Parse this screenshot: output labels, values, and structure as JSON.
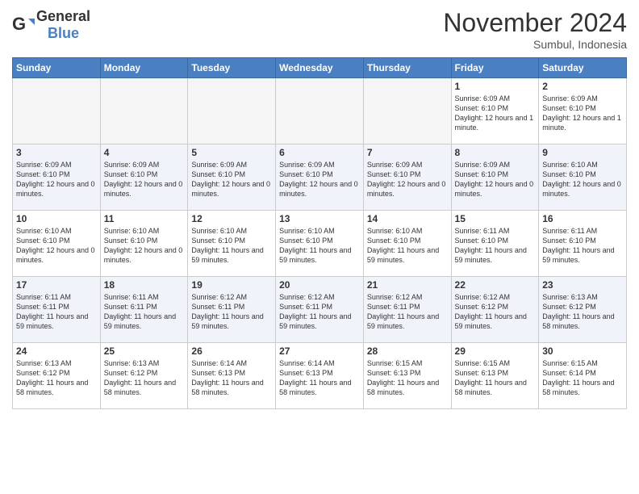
{
  "logo": {
    "text_general": "General",
    "text_blue": "Blue"
  },
  "header": {
    "month_title": "November 2024",
    "subtitle": "Sumbul, Indonesia"
  },
  "weekdays": [
    "Sunday",
    "Monday",
    "Tuesday",
    "Wednesday",
    "Thursday",
    "Friday",
    "Saturday"
  ],
  "weeks": [
    [
      {
        "day": "",
        "info": ""
      },
      {
        "day": "",
        "info": ""
      },
      {
        "day": "",
        "info": ""
      },
      {
        "day": "",
        "info": ""
      },
      {
        "day": "",
        "info": ""
      },
      {
        "day": "1",
        "info": "Sunrise: 6:09 AM\nSunset: 6:10 PM\nDaylight: 12 hours and 1 minute."
      },
      {
        "day": "2",
        "info": "Sunrise: 6:09 AM\nSunset: 6:10 PM\nDaylight: 12 hours and 1 minute."
      }
    ],
    [
      {
        "day": "3",
        "info": "Sunrise: 6:09 AM\nSunset: 6:10 PM\nDaylight: 12 hours and 0 minutes."
      },
      {
        "day": "4",
        "info": "Sunrise: 6:09 AM\nSunset: 6:10 PM\nDaylight: 12 hours and 0 minutes."
      },
      {
        "day": "5",
        "info": "Sunrise: 6:09 AM\nSunset: 6:10 PM\nDaylight: 12 hours and 0 minutes."
      },
      {
        "day": "6",
        "info": "Sunrise: 6:09 AM\nSunset: 6:10 PM\nDaylight: 12 hours and 0 minutes."
      },
      {
        "day": "7",
        "info": "Sunrise: 6:09 AM\nSunset: 6:10 PM\nDaylight: 12 hours and 0 minutes."
      },
      {
        "day": "8",
        "info": "Sunrise: 6:09 AM\nSunset: 6:10 PM\nDaylight: 12 hours and 0 minutes."
      },
      {
        "day": "9",
        "info": "Sunrise: 6:10 AM\nSunset: 6:10 PM\nDaylight: 12 hours and 0 minutes."
      }
    ],
    [
      {
        "day": "10",
        "info": "Sunrise: 6:10 AM\nSunset: 6:10 PM\nDaylight: 12 hours and 0 minutes."
      },
      {
        "day": "11",
        "info": "Sunrise: 6:10 AM\nSunset: 6:10 PM\nDaylight: 12 hours and 0 minutes."
      },
      {
        "day": "12",
        "info": "Sunrise: 6:10 AM\nSunset: 6:10 PM\nDaylight: 11 hours and 59 minutes."
      },
      {
        "day": "13",
        "info": "Sunrise: 6:10 AM\nSunset: 6:10 PM\nDaylight: 11 hours and 59 minutes."
      },
      {
        "day": "14",
        "info": "Sunrise: 6:10 AM\nSunset: 6:10 PM\nDaylight: 11 hours and 59 minutes."
      },
      {
        "day": "15",
        "info": "Sunrise: 6:11 AM\nSunset: 6:10 PM\nDaylight: 11 hours and 59 minutes."
      },
      {
        "day": "16",
        "info": "Sunrise: 6:11 AM\nSunset: 6:10 PM\nDaylight: 11 hours and 59 minutes."
      }
    ],
    [
      {
        "day": "17",
        "info": "Sunrise: 6:11 AM\nSunset: 6:11 PM\nDaylight: 11 hours and 59 minutes."
      },
      {
        "day": "18",
        "info": "Sunrise: 6:11 AM\nSunset: 6:11 PM\nDaylight: 11 hours and 59 minutes."
      },
      {
        "day": "19",
        "info": "Sunrise: 6:12 AM\nSunset: 6:11 PM\nDaylight: 11 hours and 59 minutes."
      },
      {
        "day": "20",
        "info": "Sunrise: 6:12 AM\nSunset: 6:11 PM\nDaylight: 11 hours and 59 minutes."
      },
      {
        "day": "21",
        "info": "Sunrise: 6:12 AM\nSunset: 6:11 PM\nDaylight: 11 hours and 59 minutes."
      },
      {
        "day": "22",
        "info": "Sunrise: 6:12 AM\nSunset: 6:12 PM\nDaylight: 11 hours and 59 minutes."
      },
      {
        "day": "23",
        "info": "Sunrise: 6:13 AM\nSunset: 6:12 PM\nDaylight: 11 hours and 58 minutes."
      }
    ],
    [
      {
        "day": "24",
        "info": "Sunrise: 6:13 AM\nSunset: 6:12 PM\nDaylight: 11 hours and 58 minutes."
      },
      {
        "day": "25",
        "info": "Sunrise: 6:13 AM\nSunset: 6:12 PM\nDaylight: 11 hours and 58 minutes."
      },
      {
        "day": "26",
        "info": "Sunrise: 6:14 AM\nSunset: 6:13 PM\nDaylight: 11 hours and 58 minutes."
      },
      {
        "day": "27",
        "info": "Sunrise: 6:14 AM\nSunset: 6:13 PM\nDaylight: 11 hours and 58 minutes."
      },
      {
        "day": "28",
        "info": "Sunrise: 6:15 AM\nSunset: 6:13 PM\nDaylight: 11 hours and 58 minutes."
      },
      {
        "day": "29",
        "info": "Sunrise: 6:15 AM\nSunset: 6:13 PM\nDaylight: 11 hours and 58 minutes."
      },
      {
        "day": "30",
        "info": "Sunrise: 6:15 AM\nSunset: 6:14 PM\nDaylight: 11 hours and 58 minutes."
      }
    ]
  ]
}
